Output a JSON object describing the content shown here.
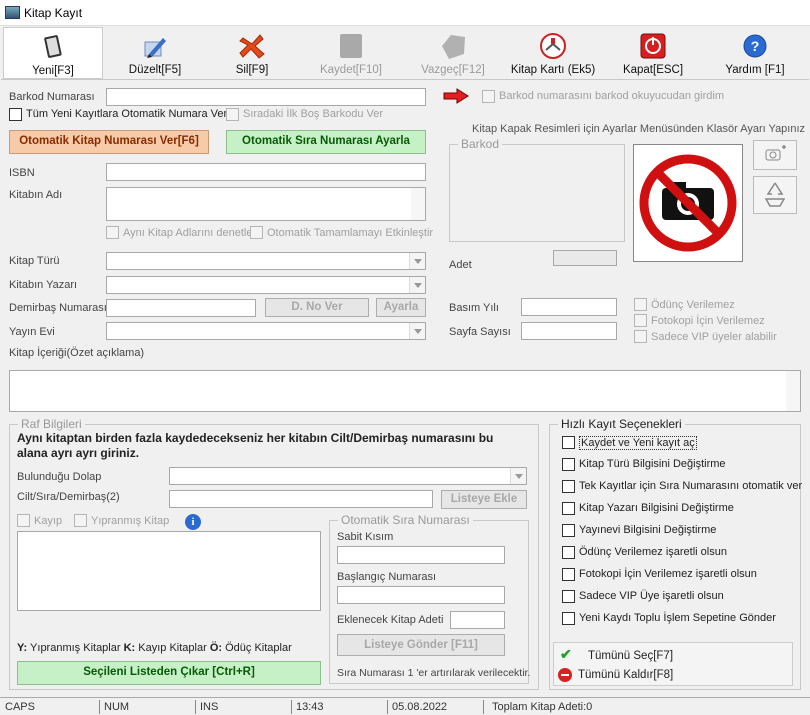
{
  "window": {
    "title": "Kitap Kayıt"
  },
  "toolbar": {
    "items": [
      {
        "label": "Yeni[F3]",
        "icon": "book-icon"
      },
      {
        "label": "Düzelt[F5]",
        "icon": "edit-pencil-icon"
      },
      {
        "label": "Sil[F9]",
        "icon": "delete-icon"
      },
      {
        "label": "Kaydet[F10]",
        "icon": "save-icon"
      },
      {
        "label": "Vazgeç[F12]",
        "icon": "undo-icon"
      },
      {
        "label": "Kitap Kartı (Ek5)",
        "icon": "library-card-icon"
      },
      {
        "label": "Kapat[ESC]",
        "icon": "power-icon"
      },
      {
        "label": "Yardım [F1]",
        "icon": "help-icon"
      }
    ]
  },
  "form": {
    "barcode_label": "Barkod Numarası",
    "auto_number_all": "Tüm Yeni Kayıtlara Otomatik Numara Ver",
    "next_empty_barcode": "Sıradaki İlk Boş Barkodu Ver",
    "read_from_reader": "Barkod numarasını barkod okuyucudan girdim",
    "auto_book_number_btn": "Otomatik Kitap Numarası Ver[F6]",
    "auto_seq_btn": "Otomatik Sıra Numarası Ayarla",
    "cover_info": "Kitap Kapak Resimleri için Ayarlar Menüsünden Klasör Ayarı Yapınız",
    "barkod_group": "Barkod",
    "isbn_label": "ISBN",
    "title_label": "Kitabın Adı",
    "check_same_names": "Aynı Kitap Adlarını denetle",
    "auto_complete": "Otomatik Tamamlamayı Etkinleştir",
    "type_label": "Kitap Türü",
    "author_label": "Kitabın Yazarı",
    "demirbas_label": "Demirbaş Numarası",
    "d_no_btn": "D. No Ver",
    "ayarla_btn": "Ayarla",
    "publisher_label": "Yayın Evi",
    "adet_label": "Adet",
    "basim_label": "Basım Yılı",
    "sayfa_label": "Sayfa Sayısı",
    "no_loan": "Ödünç Verilemez",
    "no_copy": "Fotokopi İçin Verilemez",
    "vip_only": "Sadece VIP üyeler alabilir",
    "summary_label": "Kitap İçeriği(Özet açıklama)"
  },
  "raf": {
    "group": "Raf Bilgileri",
    "info": "Aynı kitaptan birden fazla kaydedecekseniz her kitabın Cilt/Demirbaş numarasını bu alana ayrı ayrı giriniz.",
    "dolap_label": "Bulunduğu Dolap",
    "cilt_label": "Cilt/Sıra/Demirbaş(2)",
    "listeye_ekle": "Listeye Ekle",
    "kayip": "Kayıp",
    "yipranmis": "Yıpranmış Kitap",
    "legend_y": "Y:",
    "legend_y_text": "Yıpranmış Kitaplar",
    "legend_k": "K:",
    "legend_k_text": "Kayıp Kitaplar",
    "legend_o": "Ö:",
    "legend_o_text": "Ödüç Kitaplar",
    "remove_btn": "Seçileni Listeden Çıkar [Ctrl+R]"
  },
  "oto": {
    "group": "Otomatik Sıra Numarası",
    "sabit": "Sabit Kısım",
    "baslangic": "Başlangıç Numarası",
    "eklenecek": "Eklenecek Kitap Adeti",
    "gonder": "Listeye Gönder [F11]",
    "note": "Sıra Numarası 1 'er artırılarak verilecektir."
  },
  "hizli": {
    "group": "Hızlı Kayıt Seçenekleri",
    "options": [
      "Kaydet ve Yeni kayıt aç",
      "Kitap Türü Bilgisini Değiştirme",
      "Tek Kayıtlar için Sıra Numarasını otomatik ver",
      "Kitap Yazarı Bilgisini Değiştirme",
      "Yayınevi Bilgisini Değiştirme",
      "Ödünç Verilemez işaretli olsun",
      "Fotokopi İçin Verilemez işaretli olsun",
      "Sadece VIP Üye  işaretli olsun",
      "Yeni Kaydı Toplu İşlem Sepetine Gönder"
    ],
    "select_all": "Tümünü Seç[F7]",
    "remove_all": "Tümünü Kaldır[F8]"
  },
  "status": {
    "caps": "CAPS",
    "num": "NUM",
    "ins": "INS",
    "time": "13:43",
    "date": "05.08.2022",
    "total": "Toplam Kitap Adeti:0"
  }
}
